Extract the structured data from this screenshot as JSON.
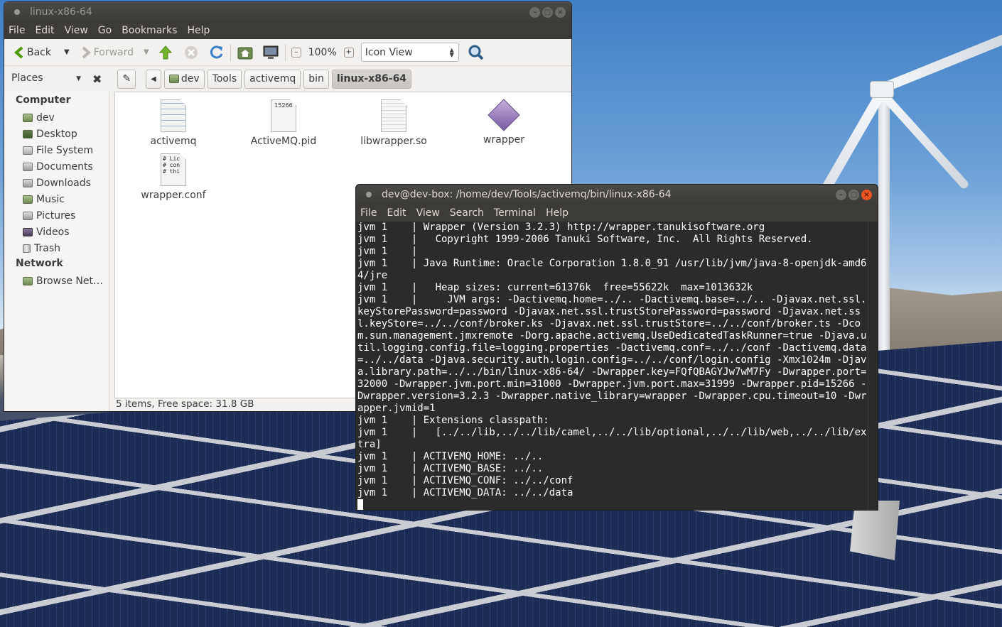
{
  "file_manager": {
    "title": "linux-x86-64",
    "menu": [
      "File",
      "Edit",
      "View",
      "Go",
      "Bookmarks",
      "Help"
    ],
    "toolbar": {
      "back_label": "Back",
      "forward_label": "Forward",
      "zoom": "100%",
      "view_mode": "Icon View"
    },
    "places_label": "Places",
    "breadcrumbs": [
      "dev",
      "Tools",
      "activemq",
      "bin",
      "linux-x86-64"
    ],
    "sidebar": {
      "computer_heading": "Computer",
      "computer_items": [
        "dev",
        "Desktop",
        "File System",
        "Documents",
        "Downloads",
        "Music",
        "Pictures",
        "Videos",
        "Trash"
      ],
      "network_heading": "Network",
      "network_items": [
        "Browse Net…"
      ]
    },
    "files": [
      {
        "name": "activemq",
        "icon": "script-file-icon"
      },
      {
        "name": "ActiveMQ.pid",
        "icon": "text-file-icon",
        "preview": "15266"
      },
      {
        "name": "libwrapper.so",
        "icon": "library-file-icon"
      },
      {
        "name": "wrapper",
        "icon": "executable-icon"
      },
      {
        "name": "wrapper.conf",
        "icon": "config-file-icon",
        "preview": "# Lic\n# con\n# thi"
      }
    ],
    "status": "5 items, Free space: 31.8 GB"
  },
  "terminal": {
    "title": "dev@dev-box: /home/dev/Tools/activemq/bin/linux-x86-64",
    "menu": [
      "File",
      "Edit",
      "View",
      "Search",
      "Terminal",
      "Help"
    ],
    "lines": [
      "jvm 1    | Wrapper (Version 3.2.3) http://wrapper.tanukisoftware.org",
      "jvm 1    |   Copyright 1999-2006 Tanuki Software, Inc.  All Rights Reserved.",
      "jvm 1    |",
      "jvm 1    | Java Runtime: Oracle Corporation 1.8.0_91 /usr/lib/jvm/java-8-openjdk-amd64/jre",
      "jvm 1    |   Heap sizes: current=61376k  free=55622k  max=1013632k",
      "jvm 1    |     JVM args: -Dactivemq.home=../.. -Dactivemq.base=../.. -Djavax.net.ssl.keyStorePassword=password -Djavax.net.ssl.trustStorePassword=password -Djavax.net.ssl.keyStore=../../conf/broker.ks -Djavax.net.ssl.trustStore=../../conf/broker.ts -Dcom.sun.management.jmxremote -Dorg.apache.activemq.UseDedicatedTaskRunner=true -Djava.util.logging.config.file=logging.properties -Dactivemq.conf=../../conf -Dactivemq.data=../../data -Djava.security.auth.login.config=../../conf/login.config -Xmx1024m -Djava.library.path=../../bin/linux-x86-64/ -Dwrapper.key=FQfQBAGYJw7wM7Fy -Dwrapper.port=32000 -Dwrapper.jvm.port.min=31000 -Dwrapper.jvm.port.max=31999 -Dwrapper.pid=15266 -Dwrapper.version=3.2.3 -Dwrapper.native_library=wrapper -Dwrapper.cpu.timeout=10 -Dwrapper.jvmid=1",
      "jvm 1    | Extensions classpath:",
      "jvm 1    |   [../../lib,../../lib/camel,../../lib/optional,../../lib/web,../../lib/extra]",
      "jvm 1    | ACTIVEMQ_HOME: ../..",
      "jvm 1    | ACTIVEMQ_BASE: ../..",
      "jvm 1    | ACTIVEMQ_CONF: ../../conf",
      "jvm 1    | ACTIVEMQ_DATA: ../../data"
    ]
  }
}
